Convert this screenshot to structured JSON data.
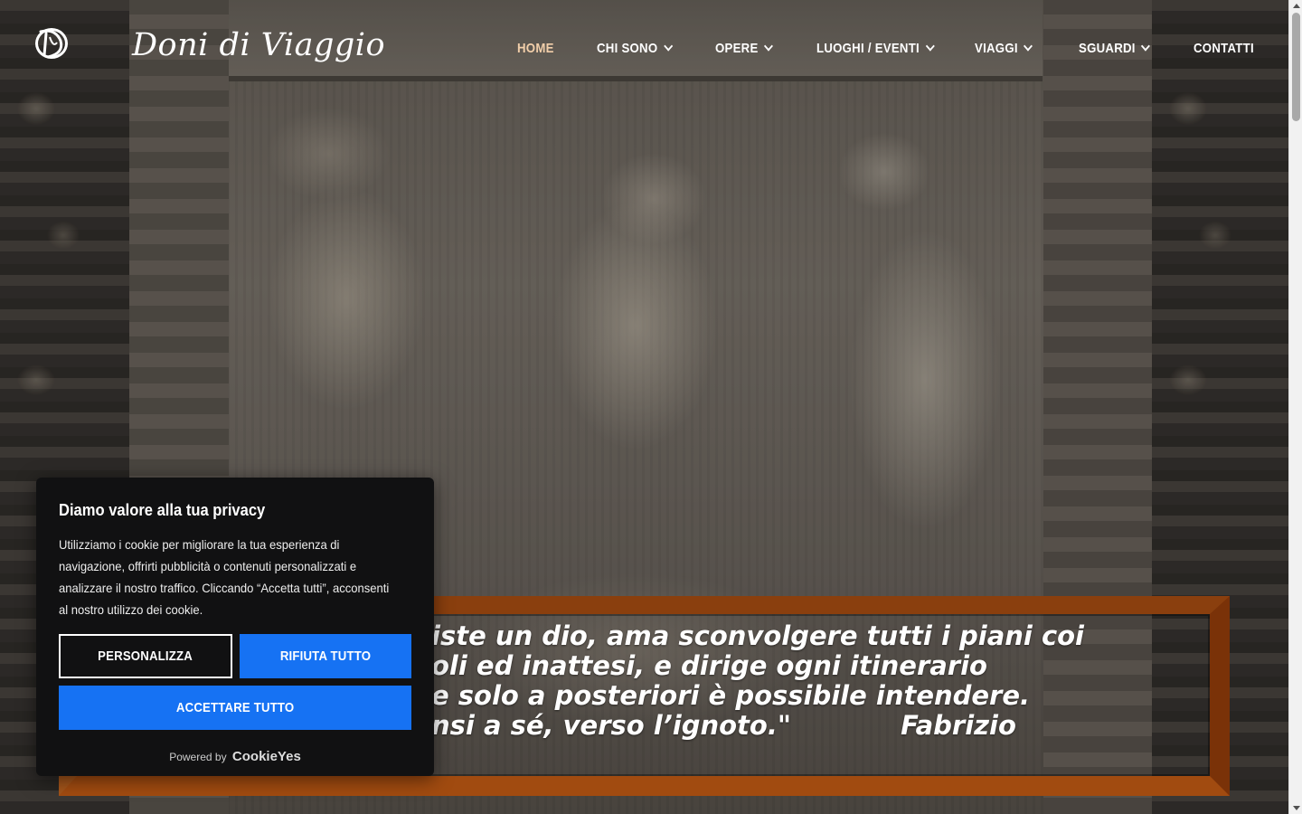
{
  "site": {
    "title": "Doni di Viaggio",
    "logo_glyph": "DV"
  },
  "nav": {
    "items": [
      {
        "label": "HOME",
        "dropdown": false,
        "active": true
      },
      {
        "label": "CHI SONO",
        "dropdown": true
      },
      {
        "label": "OPERE",
        "dropdown": true
      },
      {
        "label": "LUOGHI / EVENTI",
        "dropdown": true
      },
      {
        "label": "VIAGGI",
        "dropdown": true
      },
      {
        "label": "SGUARDI",
        "dropdown": true
      },
      {
        "label": "CONTATTI",
        "dropdown": false
      }
    ]
  },
  "quote": {
    "lines": [
      "iste un dio, ama sconvolgere tutti i piani coi",
      "oli ed inattesi, e dirige ogni itinerario",
      "e solo a posteriori è possibile intendere.",
      "nsi a sé, verso l’ignoto.\"            Fabrizio"
    ]
  },
  "cookie": {
    "title": "Diamo valore alla tua privacy",
    "body": "Utilizziamo i cookie per migliorare la tua esperienza di navigazione, offrirti pubblicità o contenuti personalizzati e analizzare il nostro traffico. Cliccando “Accetta tutti”, acconsenti al nostro utilizzo dei cookie.",
    "customize_label": "PERSONALIZZA",
    "reject_label": "RIFIUTA TUTTO",
    "accept_label": "ACCETTARE TUTTO",
    "powered_by": "Powered by",
    "brand": "CookieYes"
  },
  "colors": {
    "accent_button": "#1672f3",
    "nav_active": "#f2cfaa",
    "quote_frame": "#a2541a",
    "banner_bg": "#111112"
  }
}
